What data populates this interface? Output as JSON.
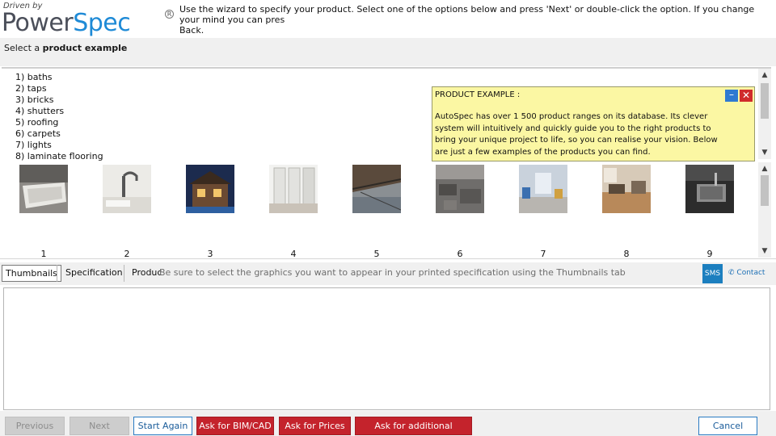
{
  "header": {
    "logo_small": "Driven by",
    "logo_part1": "Power",
    "logo_part2": "Spec",
    "logo_reg": "R",
    "intro": "Use the wizard to specify your product. Select one of the options below and press 'Next' or double-click the option. If you change your mind you can pres\nBack."
  },
  "select_bar": {
    "prefix": "Select a",
    "bold": "product example"
  },
  "options": [
    "1) baths",
    "2) taps",
    "3) bricks",
    "4) shutters",
    "5) roofing",
    "6) carpets",
    "7) lights",
    "8) laminate flooring"
  ],
  "popup": {
    "title": "PRODUCT EXAMPLE :",
    "body": "AutoSpec has over 1 500 product ranges on its database. Its clever system will intuitively and quickly guide you to the right products to bring your unique project to life, so you can realise your vision. Below are just a few examples of the products you can find.",
    "minimize": "–",
    "close": "✕"
  },
  "thumbnails": [
    "1",
    "2",
    "3",
    "4",
    "5",
    "6",
    "7",
    "8",
    "9"
  ],
  "tabs": {
    "thumbnails": "Thumbnails",
    "specification": "Specification",
    "partial": "Produc",
    "hint": "Be sure to select the graphics you want to appear in your printed specification using the Thumbnails tab",
    "sms": "SMS",
    "contact": "Contact"
  },
  "buttons": {
    "previous": "Previous",
    "next": "Next",
    "start_again": "Start Again",
    "bim_cad": "Ask for BIM/CAD",
    "prices": "Ask for Prices",
    "additional": "Ask for additional products",
    "cancel": "Cancel"
  },
  "colors": {
    "accent_blue": "#1e8ad6",
    "popup_bg": "#fbf7a3",
    "action_red": "#c4232c"
  }
}
